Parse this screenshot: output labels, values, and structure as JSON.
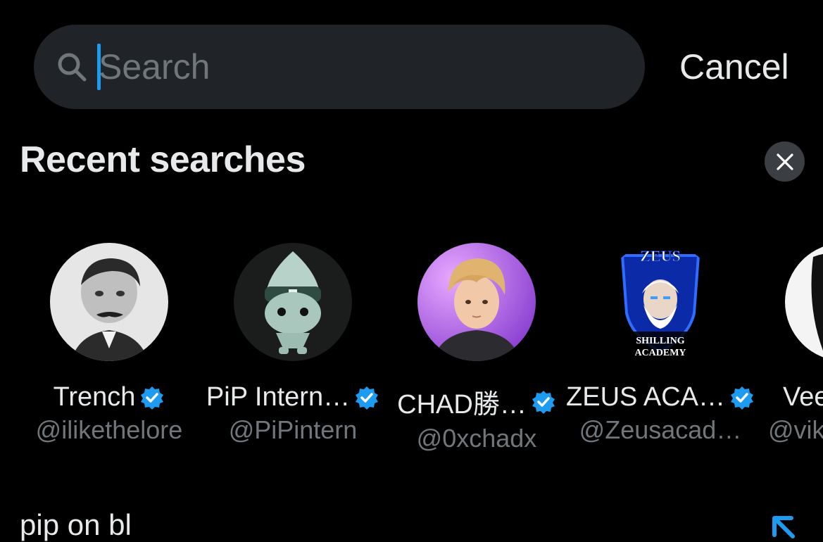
{
  "search": {
    "placeholder": "Search",
    "value": ""
  },
  "cancel_label": "Cancel",
  "recent": {
    "title": "Recent searches",
    "clear_icon": "close-icon",
    "accounts": [
      {
        "name": "Trench",
        "handle": "@ilikethelore",
        "verified": true
      },
      {
        "name": "PiP Intern…",
        "handle": "@PiPintern",
        "verified": true
      },
      {
        "name": "CHAD勝…",
        "handle": "@0xchadx",
        "verified": true
      },
      {
        "name": "ZEUS ACA…",
        "handle": "@Zeusacad…",
        "verified": true,
        "avatar_text": [
          "ZEUS",
          "SHILLING",
          "ACADEMY"
        ]
      },
      {
        "name": "Vee",
        "handle": "@vik",
        "verified": false
      }
    ],
    "query_text": "pip on bl"
  },
  "colors": {
    "background": "#000000",
    "search_bg": "#202327",
    "accent": "#1d9bf0",
    "text": "#e7e9ea",
    "muted": "#71767b"
  }
}
